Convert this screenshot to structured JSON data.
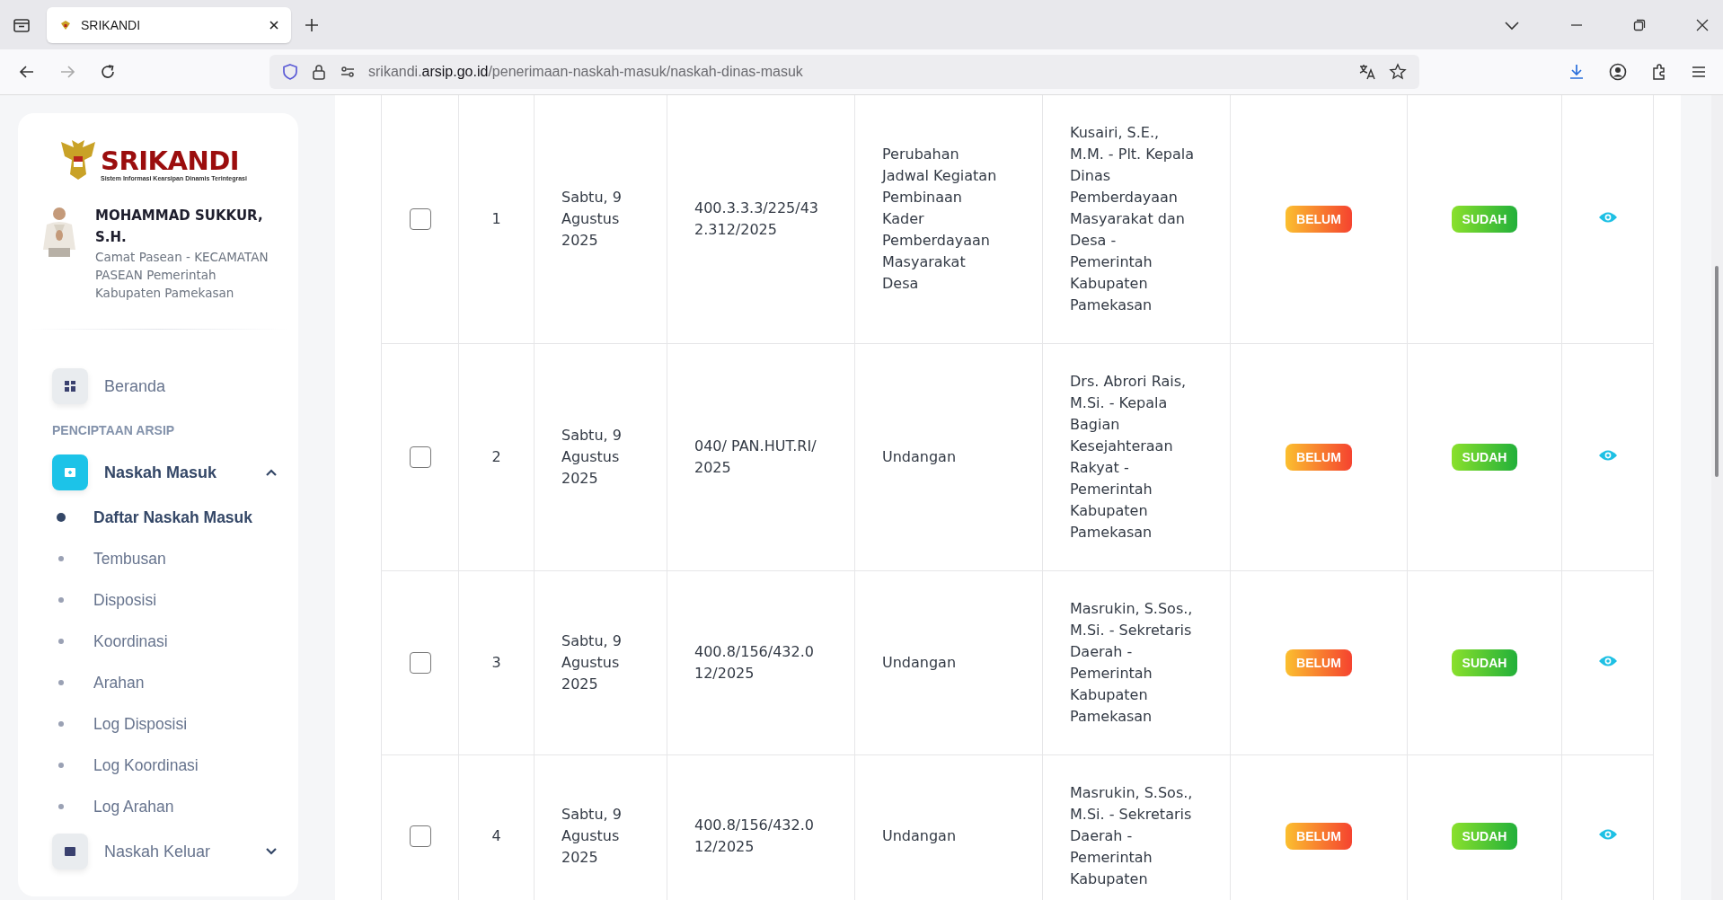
{
  "browser": {
    "tab_title": "SRIKANDI",
    "url": {
      "subdomain": "srikandi.",
      "domain": "arsip.go.id",
      "path": "/penerimaan-naskah-masuk/naskah-dinas-masuk"
    }
  },
  "sidebar": {
    "logo": {
      "title": "SRIKANDI",
      "subtitle": "Sistem Informasi Kearsipan Dinamis Terintegrasi"
    },
    "user": {
      "name": "MOHAMMAD SUKKUR, S.H.",
      "role": "Camat Pasean - KECAMATAN PASEAN Pemerintah Kabupaten Pamekasan"
    },
    "nav": [
      {
        "kind": "item",
        "label": "Beranda"
      },
      {
        "kind": "section",
        "label": "PENCIPTAAN ARSIP"
      },
      {
        "kind": "group",
        "label": "Naskah Masuk",
        "expanded": true,
        "active": true,
        "children": [
          {
            "label": "Daftar Naskah Masuk",
            "selected": true
          },
          {
            "label": "Tembusan",
            "selected": false
          },
          {
            "label": "Disposisi",
            "selected": false
          },
          {
            "label": "Koordinasi",
            "selected": false
          },
          {
            "label": "Arahan",
            "selected": false
          },
          {
            "label": "Log Disposisi",
            "selected": false
          },
          {
            "label": "Log Koordinasi",
            "selected": false
          },
          {
            "label": "Log Arahan",
            "selected": false
          }
        ]
      },
      {
        "kind": "group",
        "label": "Naskah Keluar",
        "expanded": false,
        "active": false
      }
    ]
  },
  "table": {
    "rows": [
      {
        "checked": false,
        "number": "1",
        "date": "Sabtu, 9 Agustus 2025",
        "nomor": "400.3.3.3/225/432.312/2025",
        "perihal": "Perubahan Jadwal Kegiatan Pembinaan Kader Pemberdayaan Masyarakat Desa",
        "dari": "Kusairi, S.E., M.M. - Plt. Kepala Dinas Pemberdayaan Masyarakat dan Desa - Pemerintah Kabupaten Pamekasan",
        "status_1": {
          "text": "BELUM",
          "kind": "pending"
        },
        "status_2": {
          "text": "SUDAH",
          "kind": "done"
        }
      },
      {
        "checked": false,
        "number": "2",
        "date": "Sabtu, 9 Agustus 2025",
        "nomor": "040/ PAN.HUT.RI/2025",
        "perihal": "Undangan",
        "dari": "Drs. Abrori Rais, M.Si. - Kepala Bagian Kesejahteraan Rakyat - Pemerintah Kabupaten Pamekasan",
        "status_1": {
          "text": "BELUM",
          "kind": "pending"
        },
        "status_2": {
          "text": "SUDAH",
          "kind": "done"
        }
      },
      {
        "checked": false,
        "number": "3",
        "date": "Sabtu, 9 Agustus 2025",
        "nomor": "400.8/156/432.012/2025",
        "perihal": "Undangan",
        "dari": "Masrukin, S.Sos., M.Si. - Sekretaris Daerah - Pemerintah Kabupaten Pamekasan",
        "status_1": {
          "text": "BELUM",
          "kind": "pending"
        },
        "status_2": {
          "text": "SUDAH",
          "kind": "done"
        }
      },
      {
        "checked": false,
        "number": "4",
        "date": "Sabtu, 9 Agustus 2025",
        "nomor": "400.8/156/432.012/2025",
        "perihal": "Undangan",
        "dari": "Masrukin, S.Sos., M.Si. - Sekretaris Daerah - Pemerintah Kabupaten",
        "status_1": {
          "text": "BELUM",
          "kind": "pending"
        },
        "status_2": {
          "text": "SUDAH",
          "kind": "done"
        }
      }
    ]
  }
}
